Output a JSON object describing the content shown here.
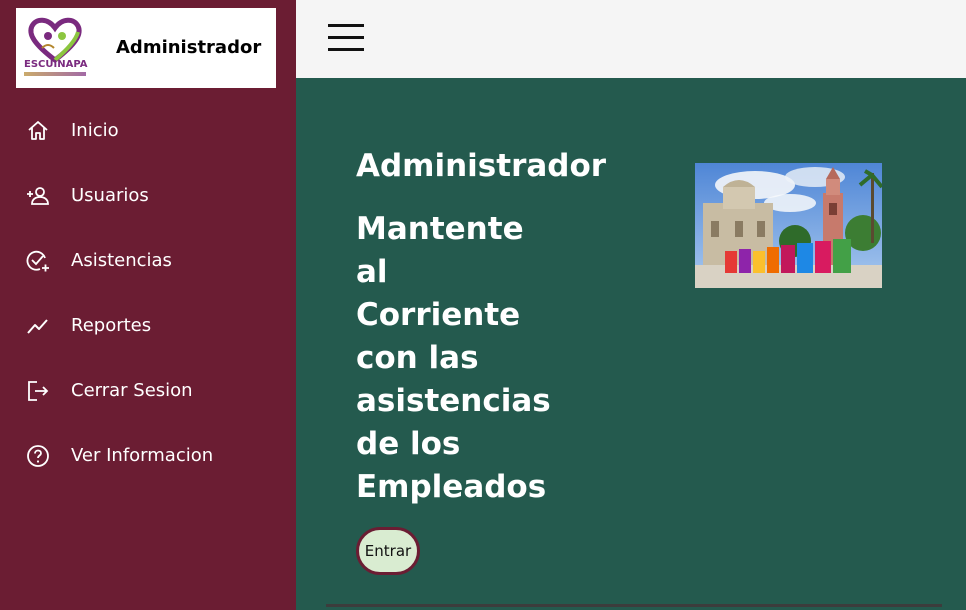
{
  "sidebar": {
    "brand": {
      "logo_icon": "escuinapa-heart-logo-icon",
      "logo_text": "ESCUINAPA",
      "title": "Administrador"
    },
    "items": [
      {
        "label": "Inicio",
        "icon": "home-icon"
      },
      {
        "label": "Usuarios",
        "icon": "add-user-icon"
      },
      {
        "label": "Asistencias",
        "icon": "check-add-icon"
      },
      {
        "label": "Reportes",
        "icon": "trend-chart-icon"
      },
      {
        "label": "Cerrar Sesion",
        "icon": "logout-icon"
      },
      {
        "label": "Ver Informacion",
        "icon": "help-circle-icon"
      }
    ]
  },
  "topbar": {
    "menu_icon": "hamburger-menu-icon"
  },
  "main": {
    "title": "Administrador",
    "subtitle": "Mantente al Corriente con las asistencias de los Empleados",
    "enter_button": "Entrar",
    "photo_alt": "ESCUINAPA town square"
  },
  "colors": {
    "sidebar_bg": "#6b1d33",
    "main_bg": "#245a4e",
    "topbar_bg": "#f5f5f5",
    "button_bg": "#d9ecd1"
  }
}
